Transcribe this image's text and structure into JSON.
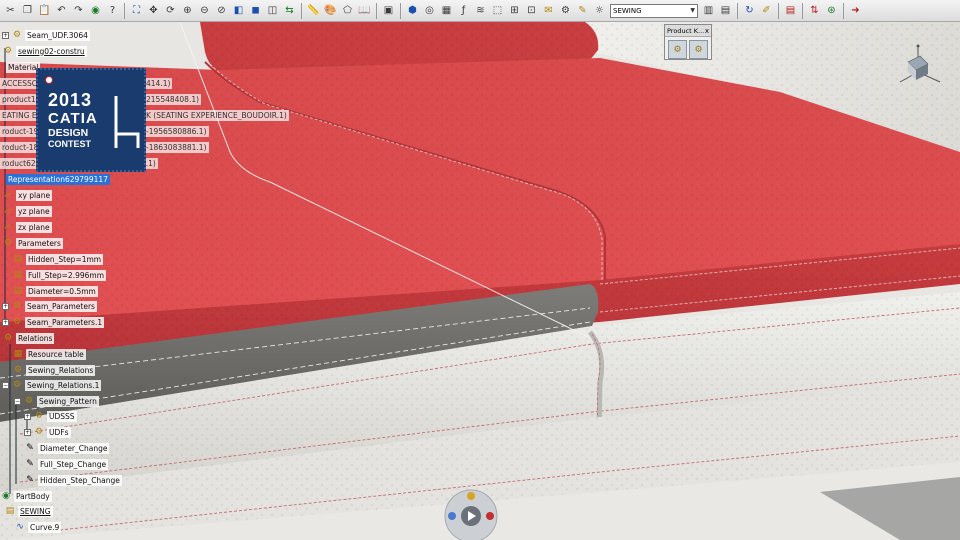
{
  "app": {
    "name": "CATIA"
  },
  "toolbar": {
    "workbench_select": {
      "value": "SEWING"
    },
    "icons": [
      "cut-icon",
      "copy-icon",
      "paste-icon",
      "undo-icon",
      "redo-icon",
      "globe-icon",
      "fit-all-icon",
      "pan-icon",
      "rotate-icon",
      "zoom-in-icon",
      "zoom-out-icon",
      "normal-view-icon",
      "iso-view-icon",
      "shading-icon",
      "hide-show-icon",
      "swap-icon",
      "measure-icon",
      "apply-material-icon",
      "shape-icon",
      "catalog-icon",
      "sketch-icon",
      "cube-icon",
      "analysis-icon",
      "table-icon",
      "formula-icon",
      "law-icon",
      "manipulate-icon",
      "snap-icon",
      "plan-icon",
      "open-doc-icon",
      "clash-icon",
      "paint-icon",
      "render-icon",
      "bars-icon",
      "globe2-icon",
      "arrow-icon"
    ]
  },
  "product_panel": {
    "title": "Product K...",
    "close_glyph": "x"
  },
  "badge": {
    "year": "2013",
    "line1": "CATIA",
    "line2": "DESIGN",
    "line3": "CONTEST"
  },
  "tree": {
    "nodes": [
      {
        "label": "Seam_UDF.3064",
        "icon": "udf-icon"
      },
      {
        "label": "sewing02-constru",
        "icon": "part-icon"
      },
      {
        "label": "Material",
        "icon": "material-icon"
      },
      {
        "label": "ACCESSOR",
        "suffix": "414.1)",
        "icon": ""
      },
      {
        "label": "product121",
        "suffix": "215548408.1)",
        "icon": ""
      },
      {
        "label": "EATING EX",
        "suffix": "K (SEATING EXPERIENCE_BOUDOIR.1)",
        "icon": ""
      },
      {
        "label": "roduct-19",
        "suffix": "-1956580886.1)",
        "icon": ""
      },
      {
        "label": "roduct-18",
        "suffix": "-1863083881.1)",
        "icon": ""
      },
      {
        "label": "roduct629799115 (Product629799115.1)",
        "icon": ""
      },
      {
        "label": "Representation629799117",
        "icon": ""
      },
      {
        "label": "xy plane",
        "icon": "plane-icon"
      },
      {
        "label": "yz plane",
        "icon": "plane-icon"
      },
      {
        "label": "zx plane",
        "icon": "plane-icon"
      },
      {
        "label": "Parameters",
        "icon": "parameters-icon"
      },
      {
        "label": "Hidden_Step=1mm",
        "icon": "parameter-icon"
      },
      {
        "label": "Full_Step=2.996mm",
        "icon": "parameter-icon"
      },
      {
        "label": "Diameter=0.5mm",
        "icon": "parameter-icon"
      },
      {
        "label": "Seam_Parameters",
        "icon": "parameter-set-icon"
      },
      {
        "label": "Seam_Parameters.1",
        "icon": "parameter-set-icon"
      },
      {
        "label": "Relations",
        "icon": "relations-icon"
      },
      {
        "label": "Resource table",
        "icon": "table-icon"
      },
      {
        "label": "Sewing_Relations",
        "icon": "relation-icon"
      },
      {
        "label": "Sewing_Relations.1",
        "icon": "relation-icon"
      },
      {
        "label": "Sewing_Pattern",
        "icon": "pattern-icon"
      },
      {
        "label": "UDSSS",
        "icon": "udf-icon"
      },
      {
        "label": "UDFs",
        "icon": "udf-icon"
      },
      {
        "label": "Diameter_Change",
        "icon": "rule-icon"
      },
      {
        "label": "Full_Step_Change",
        "icon": "rule-icon"
      },
      {
        "label": "Hidden_Step_Change",
        "icon": "rule-icon"
      },
      {
        "label": "PartBody",
        "icon": "body-icon"
      },
      {
        "label": "SEWING",
        "icon": "geometrical-set-icon"
      },
      {
        "label": "Curve.9",
        "icon": "curve-icon"
      }
    ]
  }
}
